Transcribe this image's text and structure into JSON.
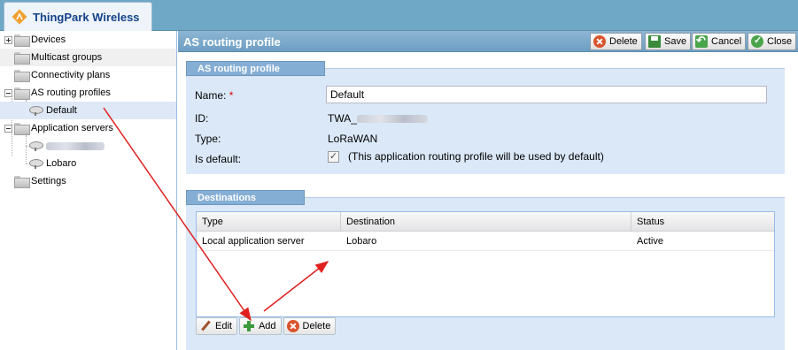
{
  "app": {
    "title": "ThingPark Wireless"
  },
  "tree": {
    "items": [
      {
        "label": "Devices"
      },
      {
        "label": "Multicast groups"
      },
      {
        "label": "Connectivity plans"
      },
      {
        "label": "AS routing profiles"
      },
      {
        "label": "Default"
      },
      {
        "label": "Application servers"
      },
      {
        "label": ""
      },
      {
        "label": "Lobaro"
      },
      {
        "label": "Settings"
      }
    ]
  },
  "panel": {
    "title": "AS routing profile",
    "toolbar": {
      "delete": "Delete",
      "save": "Save",
      "cancel": "Cancel",
      "close": "Close"
    }
  },
  "profile": {
    "legend": "AS routing profile",
    "name_label": "Name:",
    "required_mark": "*",
    "name_value": "Default",
    "id_label": "ID:",
    "id_value": "TWA_",
    "type_label": "Type:",
    "type_value": "LoRaWAN",
    "default_label": "Is default:",
    "default_checked": true,
    "default_text": "(This application routing profile will be used by default)"
  },
  "destinations": {
    "legend": "Destinations",
    "columns": [
      "Type",
      "Destination",
      "Status"
    ],
    "rows": [
      {
        "type": "Local application server",
        "destination": "Lobaro",
        "status": "Active"
      }
    ],
    "buttons": {
      "edit": "Edit",
      "add": "Add",
      "delete": "Delete"
    }
  },
  "colors": {
    "header": "#6fa8c7",
    "fieldset": "#dbe8f7",
    "legend": "#85aed4",
    "arrow": "#e02020"
  }
}
